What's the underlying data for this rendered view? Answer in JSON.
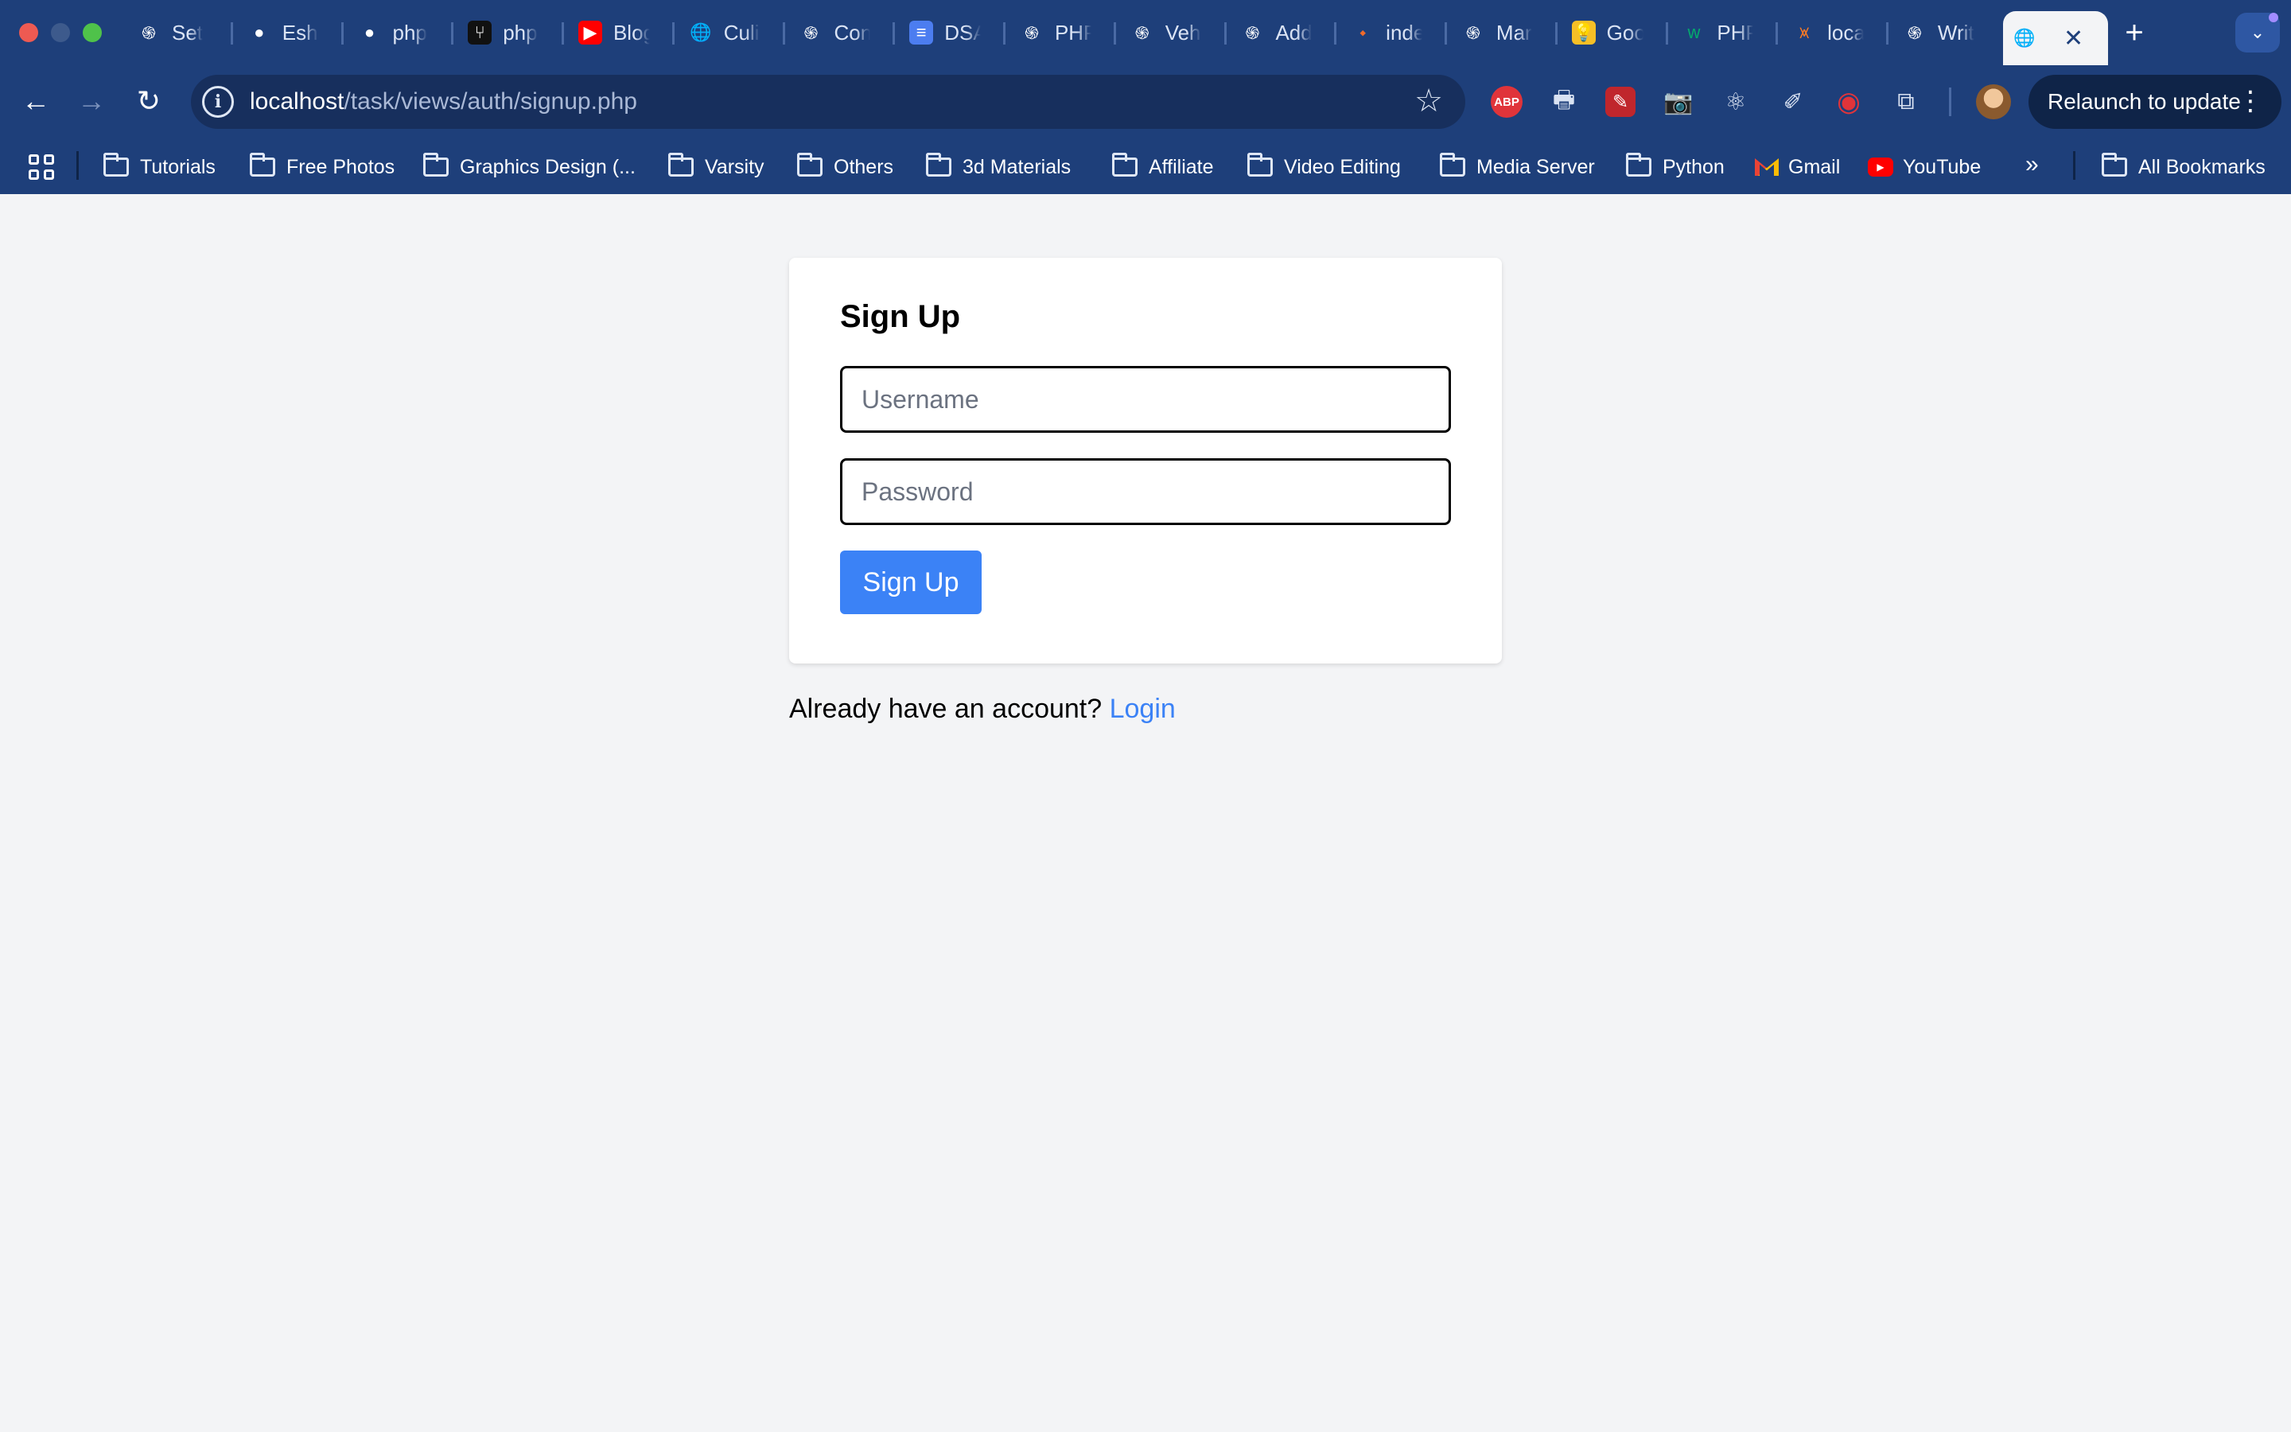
{
  "browser": {
    "tabs": [
      {
        "label": "Set",
        "icon": "openai-icon"
      },
      {
        "label": "Esh",
        "icon": "github-icon"
      },
      {
        "label": "php",
        "icon": "github-icon"
      },
      {
        "label": "php",
        "icon": "git-icon"
      },
      {
        "label": "Blog",
        "icon": "youtube-icon"
      },
      {
        "label": "Culi",
        "icon": "globe-icon"
      },
      {
        "label": "Con",
        "icon": "openai-icon"
      },
      {
        "label": "DSA",
        "icon": "docs-icon"
      },
      {
        "label": "PHP",
        "icon": "openai-icon"
      },
      {
        "label": "Veh",
        "icon": "openai-icon"
      },
      {
        "label": "Add",
        "icon": "openai-icon"
      },
      {
        "label": "inde",
        "icon": "drawio-icon"
      },
      {
        "label": "Mar",
        "icon": "openai-icon"
      },
      {
        "label": "Goo",
        "icon": "keep-icon"
      },
      {
        "label": "PHP",
        "icon": "w3-icon"
      },
      {
        "label": "loca",
        "icon": "xampp-icon"
      },
      {
        "label": "Writ",
        "icon": "openai-icon"
      }
    ],
    "active_tab": {
      "label": "",
      "icon": "globe-icon"
    },
    "url_host": "localhost",
    "url_path": "/task/views/auth/signup.php",
    "relaunch_label": "Relaunch to update",
    "extensions": [
      "abp-icon",
      "printer-icon",
      "wand-icon",
      "camera-icon",
      "react-icon",
      "pen-icon",
      "record-icon",
      "puzzle-icon"
    ],
    "abp_text": "ABP",
    "bookmarks": [
      "Tutorials",
      "Free Photos",
      "Graphics Design (...",
      "Varsity",
      "Others",
      "3d Materials",
      "Affiliate",
      "Video Editing",
      "Media Server",
      "Python"
    ],
    "gmail_label": "Gmail",
    "youtube_label": "YouTube",
    "all_bookmarks_label": "All Bookmarks"
  },
  "form": {
    "title": "Sign Up",
    "username_placeholder": "Username",
    "password_placeholder": "Password",
    "submit_label": "Sign Up"
  },
  "footer": {
    "prompt": "Already have an account? ",
    "login_link": "Login"
  },
  "colors": {
    "chrome": "#1e3f7a",
    "page_bg": "#f3f4f6",
    "primary": "#3b82f6"
  }
}
